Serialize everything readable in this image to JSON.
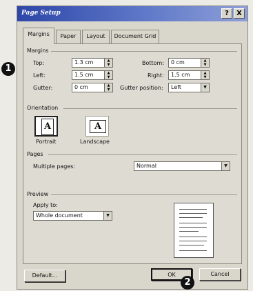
{
  "dialog": {
    "title": "Page Setup",
    "help_label": "?",
    "close_label": "X"
  },
  "tabs": [
    {
      "label": "Margins",
      "active": true
    },
    {
      "label": "Paper",
      "active": false
    },
    {
      "label": "Layout",
      "active": false
    },
    {
      "label": "Document Grid",
      "active": false
    }
  ],
  "margins": {
    "section_label": "Margins",
    "top_label": "Top:",
    "top_value": "1.3 cm",
    "left_label": "Left:",
    "left_value": "1.5 cm",
    "gutter_label": "Gutter:",
    "gutter_value": "0 cm",
    "bottom_label": "Bottom:",
    "bottom_value": "0 cm",
    "right_label": "Right:",
    "right_value": "1.5 cm",
    "gutter_position_label": "Gutter position:",
    "gutter_position_value": "Left"
  },
  "orientation": {
    "section_label": "Orientation",
    "portrait_label": "Portrait",
    "landscape_label": "Landscape",
    "icon_letter": "A"
  },
  "pages": {
    "section_label": "Pages",
    "multiple_pages_label": "Multiple pages:",
    "multiple_pages_value": "Normal"
  },
  "preview": {
    "section_label": "Preview",
    "apply_to_label": "Apply to:",
    "apply_to_value": "Whole document"
  },
  "buttons": {
    "default_label": "Default...",
    "ok_label": "OK",
    "cancel_label": "Cancel"
  },
  "callouts": [
    "1",
    "2"
  ],
  "icons": {
    "spin_up": "▲",
    "spin_down": "▼",
    "dropdown": "▼"
  }
}
